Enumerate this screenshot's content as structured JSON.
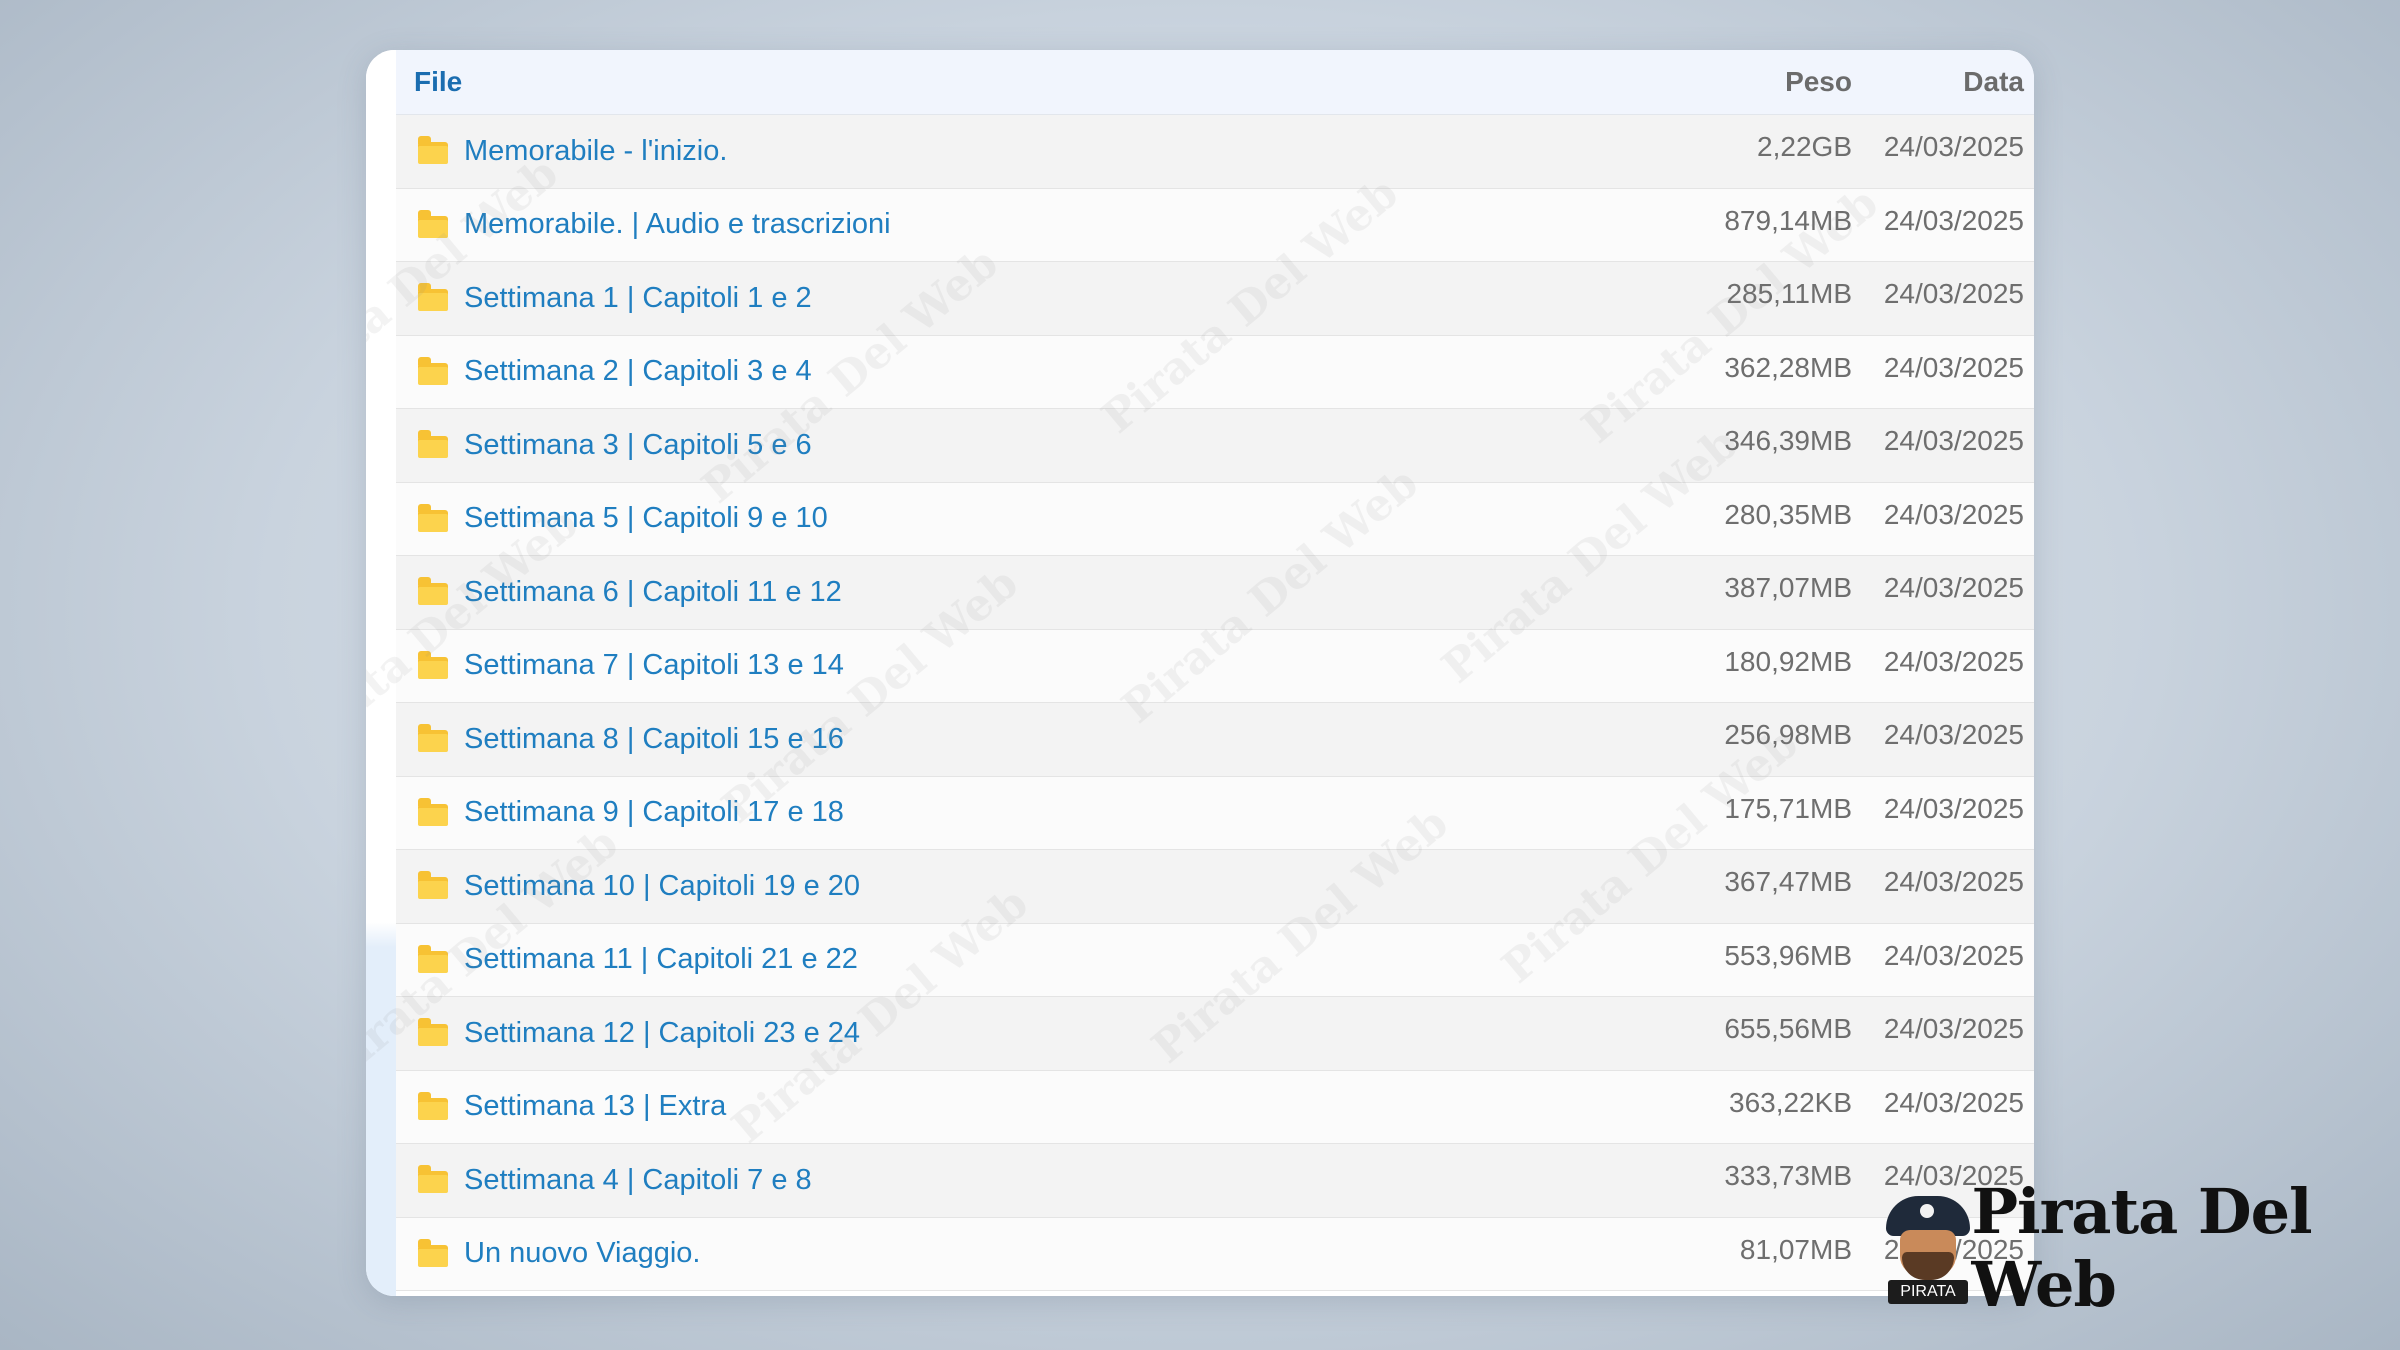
{
  "table": {
    "headers": {
      "file": "File",
      "peso": "Peso",
      "data": "Data"
    },
    "rows": [
      {
        "name": "Memorabile - l'inizio.",
        "peso": "2,22GB",
        "data": "24/03/2025"
      },
      {
        "name": "Memorabile. | Audio e trascrizioni",
        "peso": "879,14MB",
        "data": "24/03/2025"
      },
      {
        "name": "Settimana 1 | Capitoli 1 e 2",
        "peso": "285,11MB",
        "data": "24/03/2025"
      },
      {
        "name": "Settimana 2 | Capitoli 3 e 4",
        "peso": "362,28MB",
        "data": "24/03/2025"
      },
      {
        "name": "Settimana 3 | Capitoli 5 e 6",
        "peso": "346,39MB",
        "data": "24/03/2025"
      },
      {
        "name": "Settimana 5 | Capitoli 9 e 10",
        "peso": "280,35MB",
        "data": "24/03/2025"
      },
      {
        "name": "Settimana 6 | Capitoli 11 e 12",
        "peso": "387,07MB",
        "data": "24/03/2025"
      },
      {
        "name": "Settimana 7 | Capitoli 13 e 14",
        "peso": "180,92MB",
        "data": "24/03/2025"
      },
      {
        "name": "Settimana 8 | Capitoli 15 e 16",
        "peso": "256,98MB",
        "data": "24/03/2025"
      },
      {
        "name": "Settimana 9 | Capitoli 17 e 18",
        "peso": "175,71MB",
        "data": "24/03/2025"
      },
      {
        "name": "Settimana 10 | Capitoli 19 e 20",
        "peso": "367,47MB",
        "data": "24/03/2025"
      },
      {
        "name": "Settimana 11 | Capitoli 21 e 22",
        "peso": "553,96MB",
        "data": "24/03/2025"
      },
      {
        "name": "Settimana 12 | Capitoli 23 e 24",
        "peso": "655,56MB",
        "data": "24/03/2025"
      },
      {
        "name": "Settimana 13 | Extra",
        "peso": "363,22KB",
        "data": "24/03/2025"
      },
      {
        "name": "Settimana 4 | Capitoli 7 e 8",
        "peso": "333,73MB",
        "data": "24/03/2025"
      },
      {
        "name": "Un nuovo Viaggio.",
        "peso": "81,07MB",
        "data": "24/03/2025"
      }
    ]
  },
  "brand": {
    "name": "Pirata Del Web",
    "badge": "PIRATA"
  },
  "watermark": {
    "text": "Pirata Del Web"
  },
  "icons": {
    "folder": "folder-icon"
  },
  "colors": {
    "link": "#1f7ec0",
    "folder": "#f7c234",
    "header_bg": "#f1f5fd"
  }
}
